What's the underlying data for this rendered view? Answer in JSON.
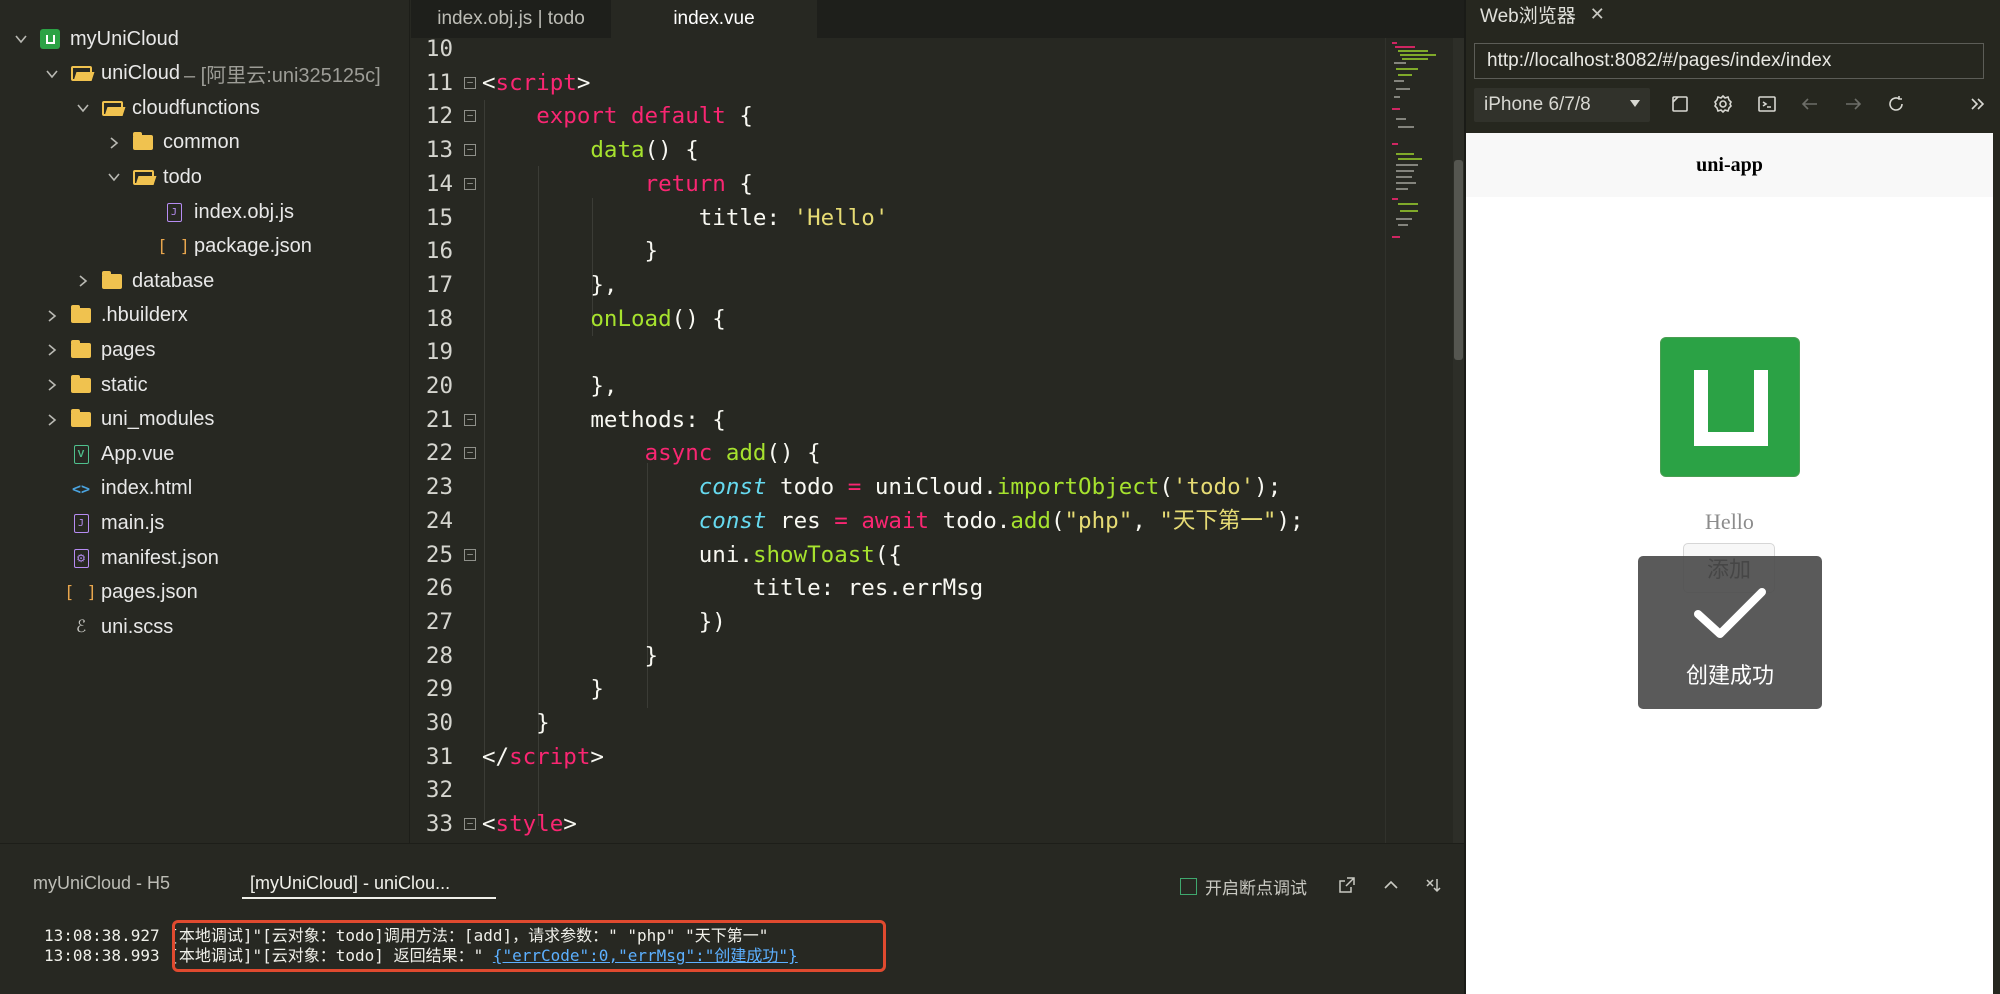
{
  "sidebar": {
    "items": [
      {
        "label": "myUniCloud",
        "suffix": "",
        "icon": "uni-project-icon",
        "expanded": true
      },
      {
        "label": "uniCloud",
        "suffix": "– [阿里云:uni325125c]",
        "icon": "folder-open-icon",
        "expanded": true
      },
      {
        "label": "cloudfunctions",
        "suffix": "",
        "icon": "folder-open-icon",
        "expanded": true
      },
      {
        "label": "common",
        "suffix": "",
        "icon": "folder-icon",
        "expanded": false
      },
      {
        "label": "todo",
        "suffix": "",
        "icon": "folder-open-icon",
        "expanded": true
      },
      {
        "label": "index.obj.js",
        "suffix": "",
        "icon": "js-file-icon"
      },
      {
        "label": "package.json",
        "suffix": "",
        "icon": "json-file-icon"
      },
      {
        "label": "database",
        "suffix": "",
        "icon": "folder-icon",
        "expanded": false
      },
      {
        "label": ".hbuilderx",
        "suffix": "",
        "icon": "folder-icon",
        "expanded": false
      },
      {
        "label": "pages",
        "suffix": "",
        "icon": "folder-icon",
        "expanded": false
      },
      {
        "label": "static",
        "suffix": "",
        "icon": "folder-icon",
        "expanded": false
      },
      {
        "label": "uni_modules",
        "suffix": "",
        "icon": "folder-icon",
        "expanded": false
      },
      {
        "label": "App.vue",
        "suffix": "",
        "icon": "vue-file-icon"
      },
      {
        "label": "index.html",
        "suffix": "",
        "icon": "html-file-icon"
      },
      {
        "label": "main.js",
        "suffix": "",
        "icon": "js-file-icon"
      },
      {
        "label": "manifest.json",
        "suffix": "",
        "icon": "manifest-file-icon"
      },
      {
        "label": "pages.json",
        "suffix": "",
        "icon": "json-file-icon"
      },
      {
        "label": "uni.scss",
        "suffix": "",
        "icon": "scss-file-icon"
      }
    ]
  },
  "tabs": [
    {
      "label": "index.obj.js | todo",
      "active": false
    },
    {
      "label": "index.vue",
      "active": true
    }
  ],
  "editor": {
    "lines": [
      {
        "n": "10",
        "fold": false,
        "tokens": []
      },
      {
        "n": "11",
        "fold": true,
        "tokens": [
          [
            "p",
            "<"
          ],
          [
            "tag",
            "script"
          ],
          [
            "p",
            ">"
          ]
        ]
      },
      {
        "n": "12",
        "fold": true,
        "tokens": [
          [
            "p",
            "    "
          ],
          [
            "kw",
            "export"
          ],
          [
            "p",
            " "
          ],
          [
            "kw",
            "default"
          ],
          [
            "p",
            " {"
          ]
        ]
      },
      {
        "n": "13",
        "fold": true,
        "tokens": [
          [
            "p",
            "        "
          ],
          [
            "fn",
            "data"
          ],
          [
            "p",
            "() {"
          ]
        ]
      },
      {
        "n": "14",
        "fold": true,
        "tokens": [
          [
            "p",
            "            "
          ],
          [
            "kw",
            "return"
          ],
          [
            "p",
            " {"
          ]
        ]
      },
      {
        "n": "15",
        "fold": false,
        "tokens": [
          [
            "p",
            "                title: "
          ],
          [
            "str",
            "'Hello'"
          ]
        ]
      },
      {
        "n": "16",
        "fold": false,
        "tokens": [
          [
            "p",
            "            }"
          ]
        ]
      },
      {
        "n": "17",
        "fold": false,
        "tokens": [
          [
            "p",
            "        },"
          ]
        ]
      },
      {
        "n": "18",
        "fold": false,
        "tokens": [
          [
            "p",
            "        "
          ],
          [
            "fn",
            "onLoad"
          ],
          [
            "p",
            "() {"
          ]
        ]
      },
      {
        "n": "19",
        "fold": false,
        "tokens": []
      },
      {
        "n": "20",
        "fold": false,
        "tokens": [
          [
            "p",
            "        },"
          ]
        ]
      },
      {
        "n": "21",
        "fold": true,
        "tokens": [
          [
            "p",
            "        methods: {"
          ]
        ]
      },
      {
        "n": "22",
        "fold": true,
        "tokens": [
          [
            "p",
            "            "
          ],
          [
            "kw",
            "async"
          ],
          [
            "p",
            " "
          ],
          [
            "fn",
            "add"
          ],
          [
            "p",
            "() {"
          ]
        ]
      },
      {
        "n": "23",
        "fold": false,
        "tokens": [
          [
            "p",
            "                "
          ],
          [
            "const",
            "const"
          ],
          [
            "p",
            " todo "
          ],
          [
            "kw",
            "="
          ],
          [
            "p",
            " uniCloud."
          ],
          [
            "fn",
            "importObject"
          ],
          [
            "p",
            "("
          ],
          [
            "str",
            "'todo'"
          ],
          [
            "p",
            ");"
          ]
        ]
      },
      {
        "n": "24",
        "fold": false,
        "tokens": [
          [
            "p",
            "                "
          ],
          [
            "const",
            "const"
          ],
          [
            "p",
            " res "
          ],
          [
            "kw",
            "="
          ],
          [
            "p",
            " "
          ],
          [
            "kw",
            "await"
          ],
          [
            "p",
            " todo."
          ],
          [
            "fn",
            "add"
          ],
          [
            "p",
            "("
          ],
          [
            "str",
            "\"php\""
          ],
          [
            "p",
            ", "
          ],
          [
            "str",
            "\"天下第一\""
          ],
          [
            "p",
            ");"
          ]
        ]
      },
      {
        "n": "25",
        "fold": true,
        "tokens": [
          [
            "p",
            "                uni."
          ],
          [
            "fn",
            "showToast"
          ],
          [
            "p",
            "({"
          ]
        ]
      },
      {
        "n": "26",
        "fold": false,
        "tokens": [
          [
            "p",
            "                    title: res.errMsg"
          ]
        ]
      },
      {
        "n": "27",
        "fold": false,
        "tokens": [
          [
            "p",
            "                })"
          ]
        ]
      },
      {
        "n": "28",
        "fold": false,
        "tokens": [
          [
            "p",
            "            }"
          ]
        ]
      },
      {
        "n": "29",
        "fold": false,
        "tokens": [
          [
            "p",
            "        }"
          ]
        ]
      },
      {
        "n": "30",
        "fold": false,
        "tokens": [
          [
            "p",
            "    }"
          ]
        ]
      },
      {
        "n": "31",
        "fold": false,
        "tokens": [
          [
            "p",
            "</"
          ],
          [
            "tag",
            "script"
          ],
          [
            "p",
            ">"
          ]
        ]
      },
      {
        "n": "32",
        "fold": false,
        "tokens": []
      },
      {
        "n": "33",
        "fold": true,
        "tokens": [
          [
            "p",
            "<"
          ],
          [
            "tag",
            "style"
          ],
          [
            "p",
            ">"
          ]
        ]
      }
    ]
  },
  "browser": {
    "tab_label": "Web浏览器",
    "url": "http://localhost:8082/#/pages/index/index",
    "device": "iPhone 6/7/8",
    "page": {
      "nav_title": "uni-app",
      "hello_text": "Hello",
      "button_label": "添加",
      "toast_text": "创建成功"
    }
  },
  "console": {
    "tabs": [
      {
        "label": "myUniCloud - H5",
        "active": false
      },
      {
        "label": "[myUniCloud] - uniClou...",
        "active": true
      }
    ],
    "breakpoint_label": "开启断点调试",
    "logs": [
      {
        "time": "13:08:38.927",
        "text": "[本地调试]\"[云对象：todo]调用方法：[add]，请求参数：\" \"php\" \"天下第一\"",
        "link": ""
      },
      {
        "time": "13:08:38.993",
        "text": "[本地调试]\"[云对象：todo] 返回结果：\" ",
        "link": "{\"errCode\":0,\"errMsg\":\"创建成功\"}"
      }
    ]
  },
  "colors": {
    "bg": "#272822",
    "accent_green": "#2ba245",
    "highlight_red": "#e04a2f",
    "link_blue": "#5cb0ff"
  }
}
